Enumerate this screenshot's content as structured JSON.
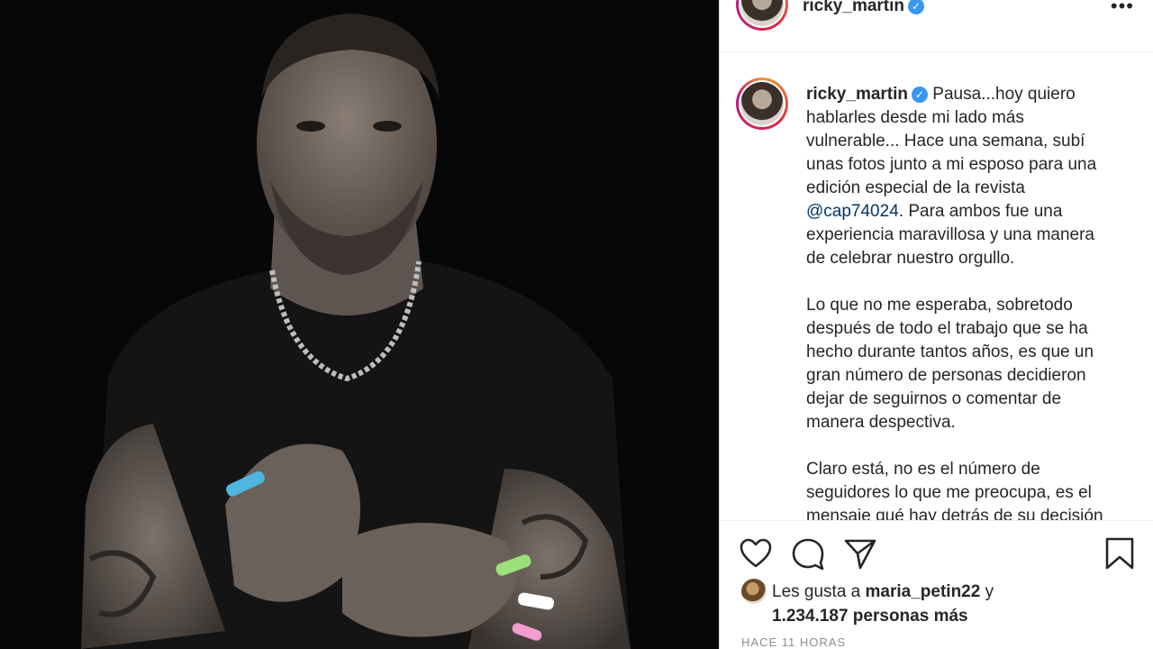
{
  "post": {
    "username": "ricky_martin",
    "verified_glyph": "✓",
    "more_label": "•••",
    "caption": {
      "username": "ricky_martin",
      "part1": " Pausa...hoy quiero\nhablarles desde mi lado más\nvulnerable... Hace una semana, subí\nunas fotos junto a mi esposo para una\nedición especial de la revista\n",
      "mention": "@cap74024",
      "part2": ". Para ambos fue una\nexperiencia maravillosa y una manera\nde celebrar nuestro orgullo.\n\nLo que no me esperaba, sobretodo\ndespués de todo el trabajo que se ha\nhecho durante tantos años, es que un\ngran número de personas decidieron\ndejar de seguirnos o comentar de\nmanera despectiva.\n\nClaro está, no es el número de\nseguidores lo que me preocupa, es el\nmensaje qué hay detrás de su decisión"
    },
    "icons": {
      "like": "heart-icon",
      "comment": "comment-icon",
      "share": "share-icon",
      "save": "bookmark-icon",
      "more": "more-options-icon"
    },
    "likes": {
      "prefix": "Les gusta a ",
      "user": "maria_petin22",
      "joiner": " y",
      "count": "1.234.187 personas más"
    },
    "timestamp": "HACE 11 HORAS"
  },
  "colors": {
    "photo_background": "#070707",
    "verified_badge": "#3897f0",
    "mention": "#00376b",
    "muted_text": "#8e8e8e"
  }
}
